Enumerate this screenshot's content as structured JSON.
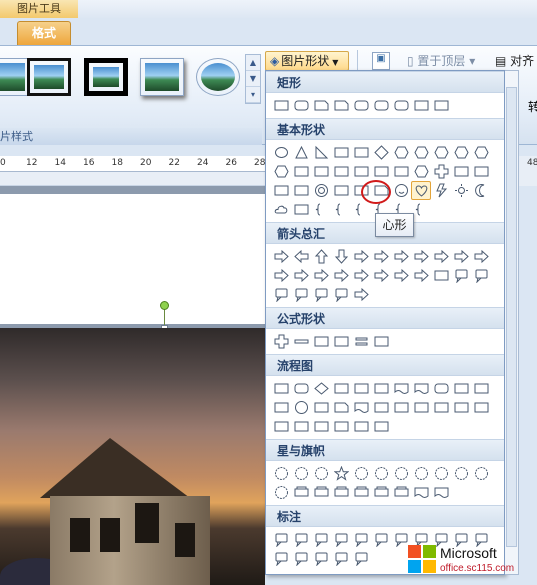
{
  "ribbon": {
    "context_tab_header": "图片工具",
    "active_tab": "格式",
    "group_label": "片样式",
    "shape_button": "图片形状",
    "bring_to_front": "置于顶层",
    "align": "对齐",
    "right_edge_char": "转"
  },
  "ruler": {
    "ticks": [
      "0",
      "12",
      "14",
      "16",
      "18",
      "20",
      "22",
      "24",
      "26",
      "28"
    ],
    "right_tick": "48"
  },
  "dropdown": {
    "categories": [
      {
        "name": "矩形",
        "shapes": [
          "rect",
          "round-rect",
          "snip-rect",
          "snip-rect-2",
          "round-rect-1",
          "round-rect-2",
          "snip-round-rect",
          "rect-2",
          "rect-3"
        ]
      },
      {
        "name": "基本形状",
        "shapes": [
          "oval",
          "triangle",
          "right-triangle",
          "parallelogram",
          "trapezoid",
          "diamond",
          "pentagon",
          "hexagon",
          "heptagon",
          "octagon",
          "decagon",
          "dodecagon",
          "pie",
          "chord",
          "teardrop",
          "frame",
          "half-frame",
          "corner",
          "diagonal-stripe",
          "plus",
          "plaque",
          "can",
          "cube",
          "bevel",
          "donut",
          "no-symbol",
          "block-arc",
          "folded-corner",
          "smiley",
          "heart",
          "lightning",
          "sun",
          "moon",
          "cloud",
          "arc",
          "double-bracket",
          "double-brace",
          "left-bracket",
          "right-bracket",
          "left-brace",
          "right-brace"
        ]
      },
      {
        "name": "箭头总汇",
        "shapes": [
          "right-arrow",
          "left-arrow",
          "up-arrow",
          "down-arrow",
          "left-right-arrow",
          "up-down-arrow",
          "quad-arrow",
          "left-right-up-arrow",
          "bent-arrow",
          "u-turn-arrow",
          "left-up-arrow",
          "bent-up-arrow",
          "curved-right-arrow",
          "curved-left-arrow",
          "curved-up-arrow",
          "curved-down-arrow",
          "striped-right-arrow",
          "notched-right-arrow",
          "pentagon-arrow",
          "chevron",
          "right-arrow-callout",
          "down-arrow-callout",
          "left-arrow-callout",
          "up-arrow-callout",
          "left-right-arrow-callout",
          "quad-arrow-callout",
          "circular-arrow"
        ]
      },
      {
        "name": "公式形状",
        "shapes": [
          "plus",
          "minus",
          "multiply",
          "divide",
          "equal",
          "not-equal"
        ]
      },
      {
        "name": "流程图",
        "shapes": [
          "process",
          "alternate-process",
          "decision",
          "data",
          "predefined-process",
          "internal-storage",
          "document",
          "multidocument",
          "terminator",
          "preparation",
          "manual-input",
          "manual-operation",
          "connector",
          "offpage-connector",
          "card",
          "punched-tape",
          "summing-junction",
          "or",
          "collate",
          "sort",
          "extract",
          "merge",
          "stored-data",
          "delay",
          "sequential-access",
          "magnetic-disk",
          "direct-access",
          "display"
        ]
      },
      {
        "name": "星与旗帜",
        "shapes": [
          "explosion-1",
          "explosion-2",
          "star-4",
          "star-5",
          "star-6",
          "star-7",
          "star-8",
          "star-10",
          "star-12",
          "star-16",
          "star-24",
          "star-32",
          "ribbon-up",
          "ribbon-down",
          "curved-ribbon-up",
          "curved-ribbon-down",
          "vertical-scroll",
          "horizontal-scroll",
          "wave",
          "double-wave"
        ]
      },
      {
        "name": "标注",
        "shapes": [
          "rect-callout",
          "round-rect-callout",
          "oval-callout",
          "cloud-callout",
          "line-callout-1",
          "line-callout-2",
          "line-callout-3",
          "line-callout-4",
          "line-callout-accent-1",
          "line-callout-accent-2",
          "line-callout-accent-3",
          "line-callout-accent-4",
          "line-callout-border-1",
          "line-callout-border-2",
          "line-callout-border-3",
          "line-callout-border-4"
        ]
      }
    ],
    "highlighted": "heart"
  },
  "tooltip": "心形",
  "watermark": {
    "brand": "Microsoft",
    "site": "office.sc115.com"
  },
  "colors": {
    "highlight_circle": "#d11a1a",
    "active_tab": "#eea63c"
  }
}
